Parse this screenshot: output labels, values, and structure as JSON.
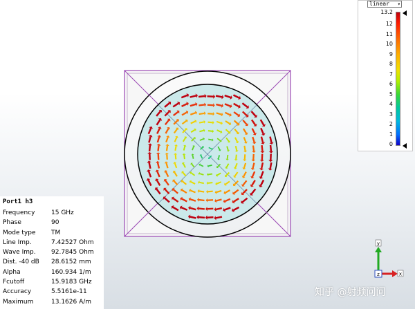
{
  "legend": {
    "scale_label": "linear",
    "max_label": "13.2",
    "ticks": [
      "12",
      "11",
      "10",
      "9",
      "8",
      "7",
      "6",
      "5",
      "4",
      "3",
      "2",
      "1",
      "0"
    ]
  },
  "info": {
    "title": "Port1 h3",
    "rows": [
      {
        "key": "Frequency",
        "value": "15 GHz"
      },
      {
        "key": "Phase",
        "value": "90"
      },
      {
        "key": "Mode type",
        "value": "TM"
      },
      {
        "key": "Line Imp.",
        "value": "7.42527 Ohm"
      },
      {
        "key": "Wave Imp.",
        "value": "92.7845 Ohm"
      },
      {
        "key": "Dist. -40 dB",
        "value": "28.6152 mm"
      },
      {
        "key": "Alpha",
        "value": "160.934 1/m"
      },
      {
        "key": "Fcutoff",
        "value": "15.9183 GHz"
      },
      {
        "key": "Accuracy",
        "value": "5.5161e-11"
      },
      {
        "key": "Maximum",
        "value": "13.1626 A/m"
      }
    ]
  },
  "axes": {
    "y": "y",
    "z": "z",
    "x": "x"
  },
  "watermark": "知乎 @射频问问",
  "colors": {
    "dielectric": "#cbe9ea",
    "outline": "#9a48b4",
    "conductor": "#000000"
  }
}
